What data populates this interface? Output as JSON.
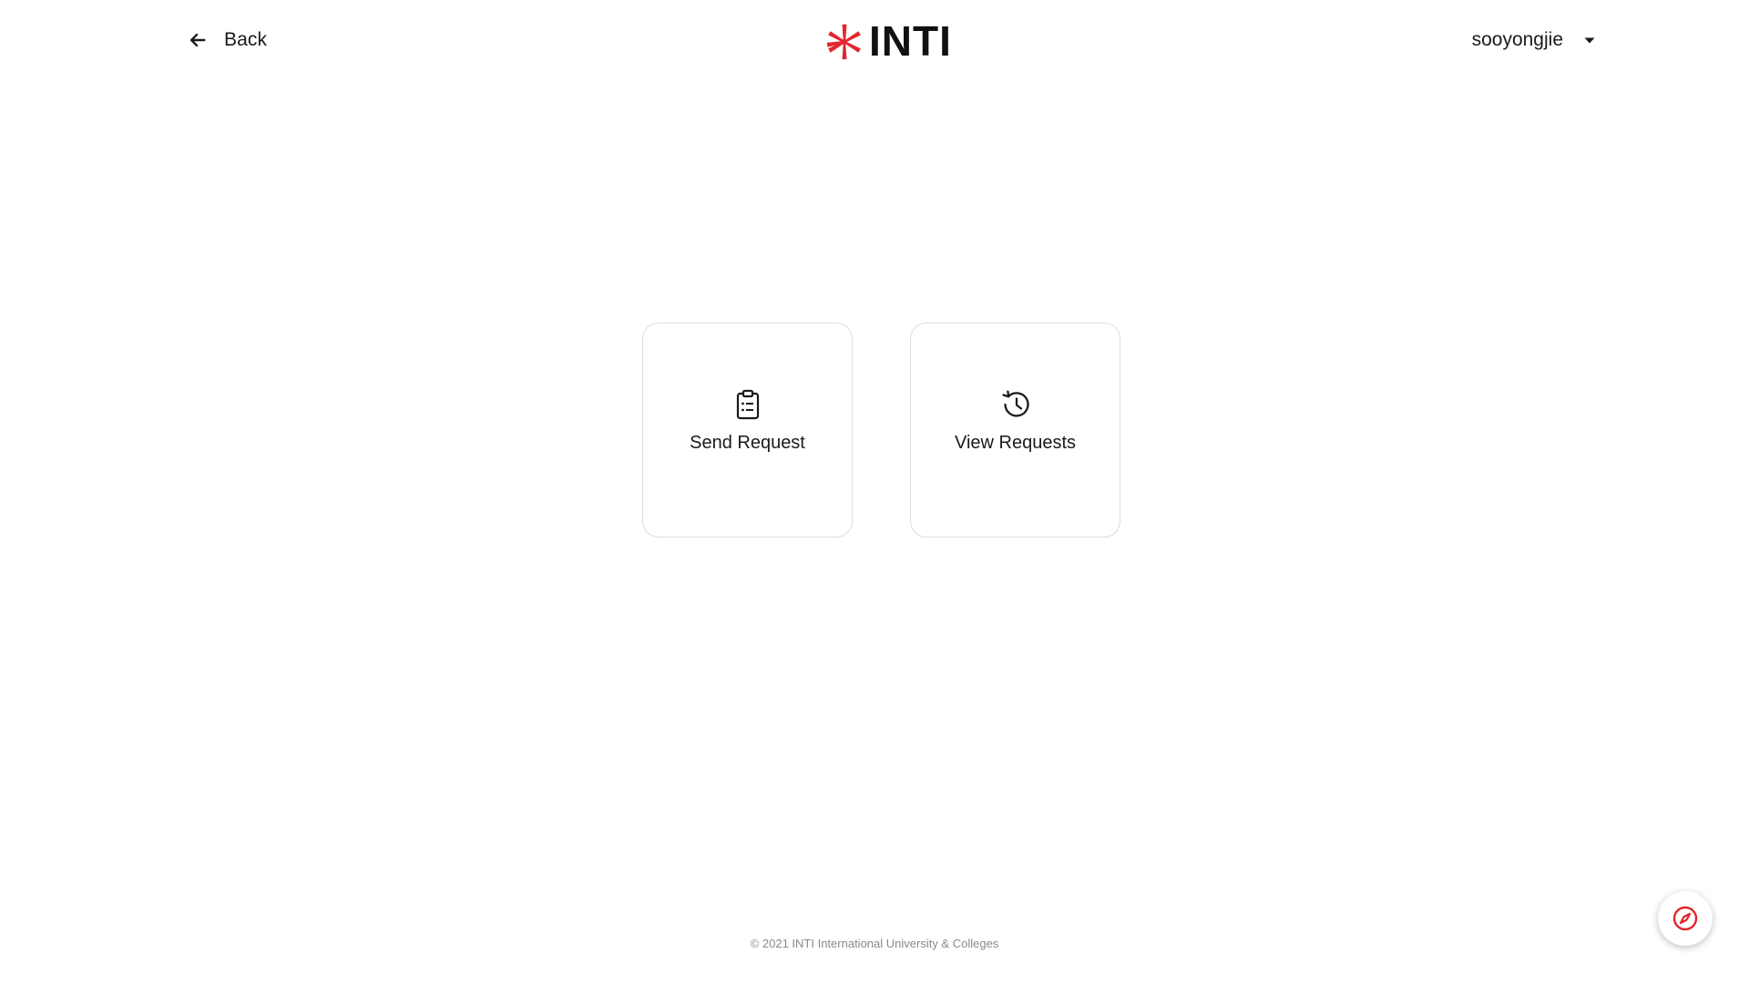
{
  "header": {
    "back_label": "Back",
    "back_icon": "arrow-left-icon",
    "logo_text": "INTI",
    "logo_icon": "inti-asterisk-logo",
    "username": "sooyongjie",
    "user_menu_icon": "caret-down-icon"
  },
  "cards": [
    {
      "label": "Send Request",
      "icon": "clipboard-list-icon"
    },
    {
      "label": "View Requests",
      "icon": "history-clock-icon"
    }
  ],
  "footer": {
    "copyright": "© 2021 INTI International University & Colleges"
  },
  "fab": {
    "icon": "compass-icon"
  },
  "colors": {
    "brand_red": "#e3262d",
    "text": "#1a1a1a",
    "card_border": "#dcdcdc",
    "footer_text": "#8a8a8a"
  }
}
